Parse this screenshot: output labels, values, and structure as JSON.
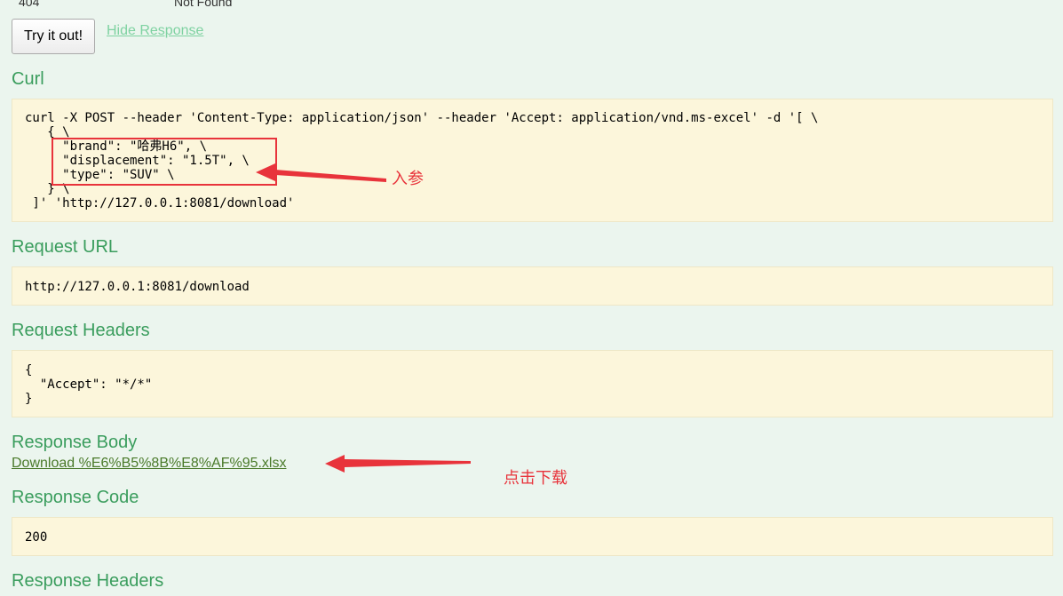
{
  "response_messages": {
    "code": "404",
    "reason": "Not Found"
  },
  "actions": {
    "try_label": "Try it out!",
    "hide_response_label": "Hide Response"
  },
  "curl": {
    "heading": "Curl",
    "command": "curl -X POST --header 'Content-Type: application/json' --header 'Accept: application/vnd.ms-excel' -d '[ \\\n   { \\\n     \"brand\": \"哈弗H6\", \\\n     \"displacement\": \"1.5T\", \\\n     \"type\": \"SUV\" \\\n   } \\\n ]' 'http://127.0.0.1:8081/download'"
  },
  "request_url": {
    "heading": "Request URL",
    "value": "http://127.0.0.1:8081/download"
  },
  "request_headers": {
    "heading": "Request Headers",
    "value": "{\n  \"Accept\": \"*/*\"\n}"
  },
  "response_body": {
    "heading": "Response Body",
    "download_link": "Download %E6%B5%8B%E8%AF%95.xlsx"
  },
  "response_code": {
    "heading": "Response Code",
    "value": "200"
  },
  "response_headers": {
    "heading": "Response Headers"
  },
  "annotations": {
    "params_label": "入参",
    "download_label": "点击下载",
    "color": "#e8333b"
  },
  "colors": {
    "background": "#ebf5ee",
    "heading": "#3a9d5d",
    "code_box": "#fcf6db",
    "link": "#7ed2a1",
    "download_link": "#4a7a2a"
  }
}
